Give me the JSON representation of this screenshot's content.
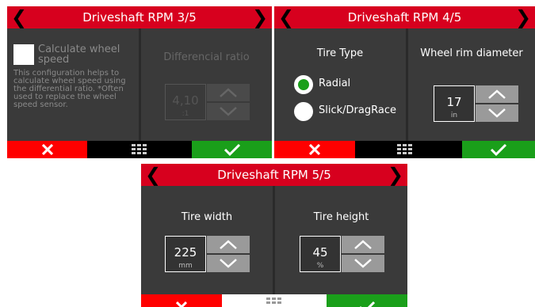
{
  "screens": [
    {
      "title": "Driveshaft RPM 3/5",
      "checkbox_label": "Calculate wheel speed",
      "description": "This configuration helps to calculate wheel speed using the differential ratio. *Often used to replace the wheel speed sensor.",
      "diff_label": "Differencial ratio",
      "diff_value": "4,10",
      "diff_unit": ":1"
    },
    {
      "title": "Driveshaft RPM 4/5",
      "tire_type_label": "Tire Type",
      "options": [
        "Radial",
        "Slick/DragRace"
      ],
      "selected": "Radial",
      "rim_label": "Wheel rim diameter",
      "rim_value": "17",
      "rim_unit": "in"
    },
    {
      "title": "Driveshaft RPM 5/5",
      "width_label": "Tire width",
      "width_value": "225",
      "width_unit": "mm",
      "height_label": "Tire height",
      "height_value": "45",
      "height_unit": "%"
    }
  ],
  "nav": {
    "prev": "❮",
    "next": "❯"
  },
  "icons": {
    "cancel": "x-icon",
    "menu": "grid-menu-icon",
    "confirm": "check-icon",
    "step_up": "chevron-up-icon",
    "step_down": "chevron-down-icon"
  },
  "colors": {
    "title_bar": "#d7001e",
    "cancel": "#ff0000",
    "confirm": "#1a9f1a",
    "panel": "#3a3a3a",
    "selected_radio": "#1a9f1a"
  }
}
